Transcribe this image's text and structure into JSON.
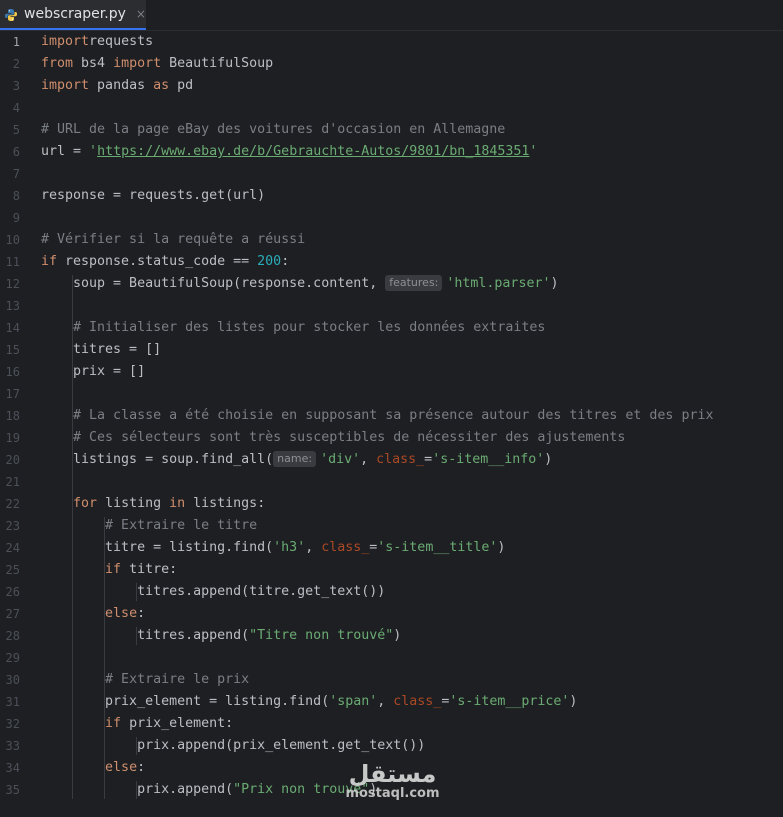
{
  "tab": {
    "filename": "webscraper.py",
    "close_glyph": "×"
  },
  "lines": [
    {
      "n": "1",
      "t": [
        [
          "kw",
          "import"
        ],
        [
          "",
          "requests"
        ]
      ]
    },
    {
      "n": "2",
      "t": [
        [
          "kw",
          "from"
        ],
        [
          "",
          " bs4 "
        ],
        [
          "kw",
          "import"
        ],
        [
          "",
          " BeautifulSoup"
        ]
      ]
    },
    {
      "n": "3",
      "t": [
        [
          "kw",
          "import"
        ],
        [
          "",
          " pandas "
        ],
        [
          "kw",
          "as"
        ],
        [
          "",
          " pd"
        ]
      ]
    },
    {
      "n": "4",
      "t": []
    },
    {
      "n": "5",
      "t": [
        [
          "cm",
          "# URL de la page eBay des voitures d'occasion en Allemagne"
        ]
      ]
    },
    {
      "n": "6",
      "t": [
        [
          "",
          "url = "
        ],
        [
          "str",
          "'"
        ],
        [
          "url",
          "https://www.ebay.de/b/Gebrauchte-Autos/9801/bn_1845351"
        ],
        [
          "str",
          "'"
        ]
      ]
    },
    {
      "n": "7",
      "t": []
    },
    {
      "n": "8",
      "t": [
        [
          "",
          "response = requests.get(url)"
        ]
      ]
    },
    {
      "n": "9",
      "t": []
    },
    {
      "n": "10",
      "t": [
        [
          "cm",
          "# Vérifier si la requête a réussi"
        ]
      ]
    },
    {
      "n": "11",
      "t": [
        [
          "kw",
          "if"
        ],
        [
          "",
          " response.status_code == "
        ],
        [
          "num",
          "200"
        ],
        [
          "",
          ":"
        ]
      ]
    },
    {
      "n": "12",
      "t": [
        [
          "",
          "    soup = BeautifulSoup(response.content, "
        ],
        [
          "hint",
          "features:"
        ],
        [
          "str",
          "'html.parser'"
        ],
        [
          "",
          ")"
        ]
      ]
    },
    {
      "n": "13",
      "t": []
    },
    {
      "n": "14",
      "t": [
        [
          "",
          "    "
        ],
        [
          "cm",
          "# Initialiser des listes pour stocker les données extraites"
        ]
      ]
    },
    {
      "n": "15",
      "t": [
        [
          "",
          "    titres = []"
        ]
      ]
    },
    {
      "n": "16",
      "t": [
        [
          "",
          "    prix = []"
        ]
      ]
    },
    {
      "n": "17",
      "t": []
    },
    {
      "n": "18",
      "t": [
        [
          "",
          "    "
        ],
        [
          "cm",
          "# La classe a été choisie en supposant sa présence autour des titres et des prix"
        ]
      ]
    },
    {
      "n": "19",
      "t": [
        [
          "",
          "    "
        ],
        [
          "cm",
          "# Ces sélecteurs sont très susceptibles de nécessiter des ajustements"
        ]
      ]
    },
    {
      "n": "20",
      "t": [
        [
          "",
          "    listings = soup.find_all("
        ],
        [
          "hint",
          "name:"
        ],
        [
          "str",
          "'div'"
        ],
        [
          "",
          ", "
        ],
        [
          "param",
          "class_"
        ],
        [
          "",
          "="
        ],
        [
          "str",
          "'s-item__info'"
        ],
        [
          "",
          ")"
        ]
      ]
    },
    {
      "n": "21",
      "t": []
    },
    {
      "n": "22",
      "t": [
        [
          "",
          "    "
        ],
        [
          "kw",
          "for"
        ],
        [
          "",
          " listing "
        ],
        [
          "kw",
          "in"
        ],
        [
          "",
          " listings:"
        ]
      ]
    },
    {
      "n": "23",
      "t": [
        [
          "",
          "        "
        ],
        [
          "cm",
          "# Extraire le titre"
        ]
      ]
    },
    {
      "n": "24",
      "t": [
        [
          "",
          "        titre = listing.find("
        ],
        [
          "str",
          "'h3'"
        ],
        [
          "",
          ", "
        ],
        [
          "param",
          "class_"
        ],
        [
          "",
          "="
        ],
        [
          "str",
          "'s-item__title'"
        ],
        [
          "",
          ")"
        ]
      ]
    },
    {
      "n": "25",
      "t": [
        [
          "",
          "        "
        ],
        [
          "kw",
          "if"
        ],
        [
          "",
          " titre:"
        ]
      ]
    },
    {
      "n": "26",
      "t": [
        [
          "",
          "            titres.append(titre.get_text())"
        ]
      ]
    },
    {
      "n": "27",
      "t": [
        [
          "",
          "        "
        ],
        [
          "kw",
          "else"
        ],
        [
          "",
          ":"
        ]
      ]
    },
    {
      "n": "28",
      "t": [
        [
          "",
          "            titres.append("
        ],
        [
          "str",
          "\"Titre non trouvé\""
        ],
        [
          "",
          ")"
        ]
      ]
    },
    {
      "n": "29",
      "t": []
    },
    {
      "n": "30",
      "t": [
        [
          "",
          "        "
        ],
        [
          "cm",
          "# Extraire le prix"
        ]
      ]
    },
    {
      "n": "31",
      "t": [
        [
          "",
          "        prix_element = listing.find("
        ],
        [
          "str",
          "'span'"
        ],
        [
          "",
          ", "
        ],
        [
          "param",
          "class_"
        ],
        [
          "",
          "="
        ],
        [
          "str",
          "'s-item__price'"
        ],
        [
          "",
          ")"
        ]
      ]
    },
    {
      "n": "32",
      "t": [
        [
          "",
          "        "
        ],
        [
          "kw",
          "if"
        ],
        [
          "",
          " prix_element:"
        ]
      ]
    },
    {
      "n": "33",
      "t": [
        [
          "",
          "            prix.append(prix_element.get_text())"
        ]
      ]
    },
    {
      "n": "34",
      "t": [
        [
          "",
          "        "
        ],
        [
          "kw",
          "else"
        ],
        [
          "",
          ":"
        ]
      ]
    },
    {
      "n": "35",
      "t": [
        [
          "",
          "            prix.append("
        ],
        [
          "str",
          "\"Prix non trouvé\""
        ],
        [
          "",
          ")"
        ]
      ]
    }
  ],
  "watermark": {
    "arabic": "مستقل",
    "latin": "mostaql.com"
  },
  "colors": {
    "background": "#1e1f22",
    "keyword": "#cf8e6d",
    "string": "#6aab73",
    "comment": "#7a7e85",
    "number": "#2aacb8",
    "param": "#aa4926",
    "text": "#bcbec4",
    "tab_accent": "#3574f0"
  }
}
